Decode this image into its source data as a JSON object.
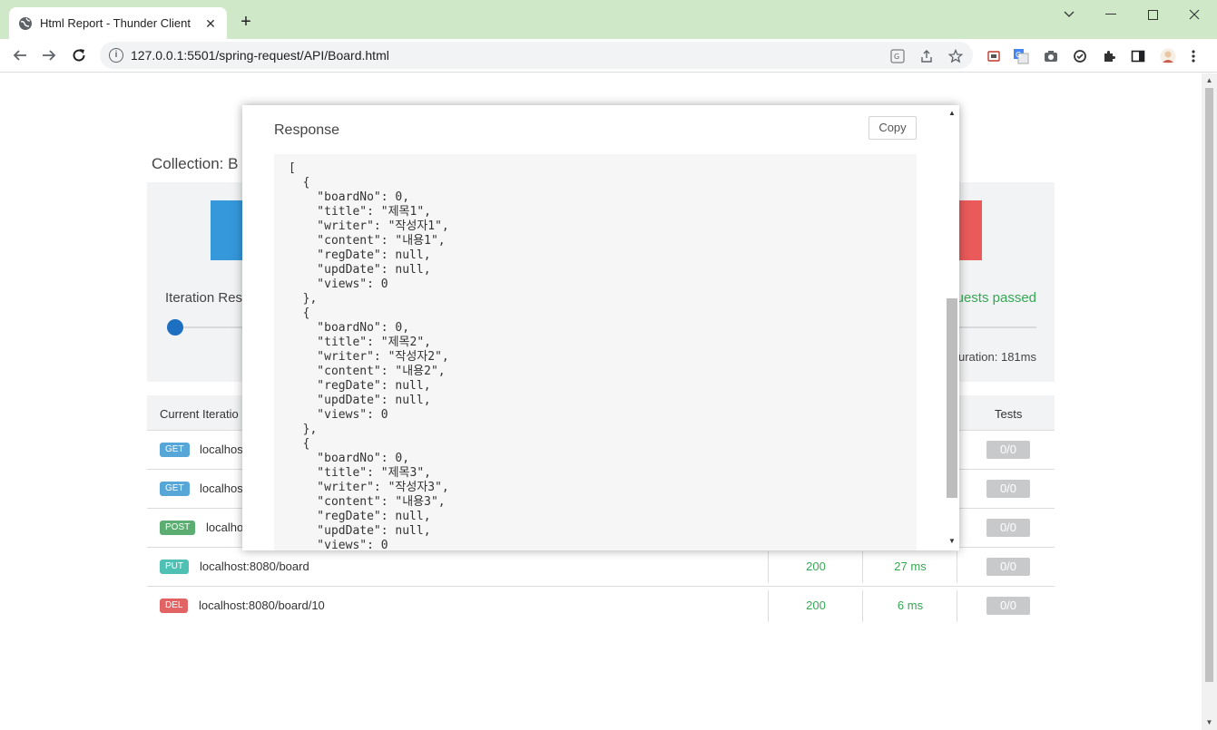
{
  "browser": {
    "tab_title": "Html Report - Thunder Client",
    "url": "127.0.0.1:5501/spring-request/API/Board.html"
  },
  "report": {
    "collection_title": "Collection: B",
    "iteration_label": "Iteration Res",
    "passed_text": "uests passed",
    "duration_text": "uration: 181ms",
    "table": {
      "headers": {
        "iteration": "Current Iteratio",
        "tests": "Tests"
      },
      "rows": [
        {
          "method": "GET",
          "url": "localhos",
          "status": "",
          "time": "",
          "tests": "0/0"
        },
        {
          "method": "GET",
          "url": "localhos",
          "status": "",
          "time": "",
          "tests": "0/0"
        },
        {
          "method": "POST",
          "url": "localho",
          "status": "",
          "time": "",
          "tests": "0/0"
        },
        {
          "method": "PUT",
          "url": "localhost:8080/board",
          "status": "200",
          "time": "27 ms",
          "tests": "0/0"
        },
        {
          "method": "DEL",
          "url": "localhost:8080/board/10",
          "status": "200",
          "time": "6 ms",
          "tests": "0/0"
        }
      ]
    }
  },
  "modal": {
    "title": "Response",
    "copy_label": "Copy",
    "body": "[\n  {\n    \"boardNo\": 0,\n    \"title\": \"제목1\",\n    \"writer\": \"작성자1\",\n    \"content\": \"내용1\",\n    \"regDate\": null,\n    \"updDate\": null,\n    \"views\": 0\n  },\n  {\n    \"boardNo\": 0,\n    \"title\": \"제목2\",\n    \"writer\": \"작성자2\",\n    \"content\": \"내용2\",\n    \"regDate\": null,\n    \"updDate\": null,\n    \"views\": 0\n  },\n  {\n    \"boardNo\": 0,\n    \"title\": \"제목3\",\n    \"writer\": \"작성자3\",\n    \"content\": \"내용3\",\n    \"regDate\": null,\n    \"updDate\": null,\n    \"views\": 0"
  },
  "colors": {
    "tabbar": "#cfe8c8",
    "accent_blue": "#3598db",
    "accent_red": "#ea5a5a",
    "success_green": "#34a853"
  }
}
